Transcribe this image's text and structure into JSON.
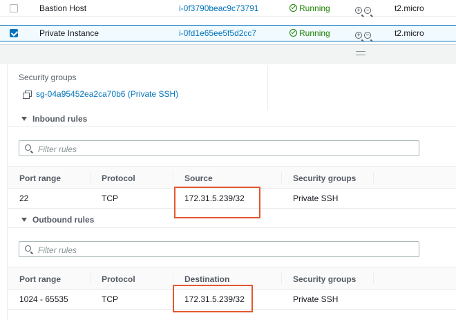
{
  "instances": [
    {
      "name": "Bastion Host",
      "id": "i-0f3790beac9c73791",
      "state": "Running",
      "type": "t2.micro",
      "selected": false
    },
    {
      "name": "Private Instance",
      "id": "i-0fd1e65ee5f5d2cc7",
      "state": "Running",
      "type": "t2.micro",
      "selected": true
    }
  ],
  "details": {
    "security_groups_label": "Security groups",
    "security_group_link": "sg-04a95452ea2ca70b6 (Private SSH)"
  },
  "inbound": {
    "title": "Inbound rules",
    "filter_placeholder": "Filter rules",
    "columns": [
      "Port range",
      "Protocol",
      "Source",
      "Security groups"
    ],
    "rows": [
      {
        "port_range": "22",
        "protocol": "TCP",
        "source": "172.31.5.239/32",
        "security_group": "Private SSH"
      }
    ]
  },
  "outbound": {
    "title": "Outbound rules",
    "filter_placeholder": "Filter rules",
    "columns": [
      "Port range",
      "Protocol",
      "Destination",
      "Security groups"
    ],
    "rows": [
      {
        "port_range": "1024 - 65535",
        "protocol": "TCP",
        "destination": "172.31.5.239/32",
        "security_group": "Private SSH"
      }
    ]
  },
  "colors": {
    "link": "#0073bb",
    "running": "#1d8102",
    "highlight": "#e4572e"
  }
}
